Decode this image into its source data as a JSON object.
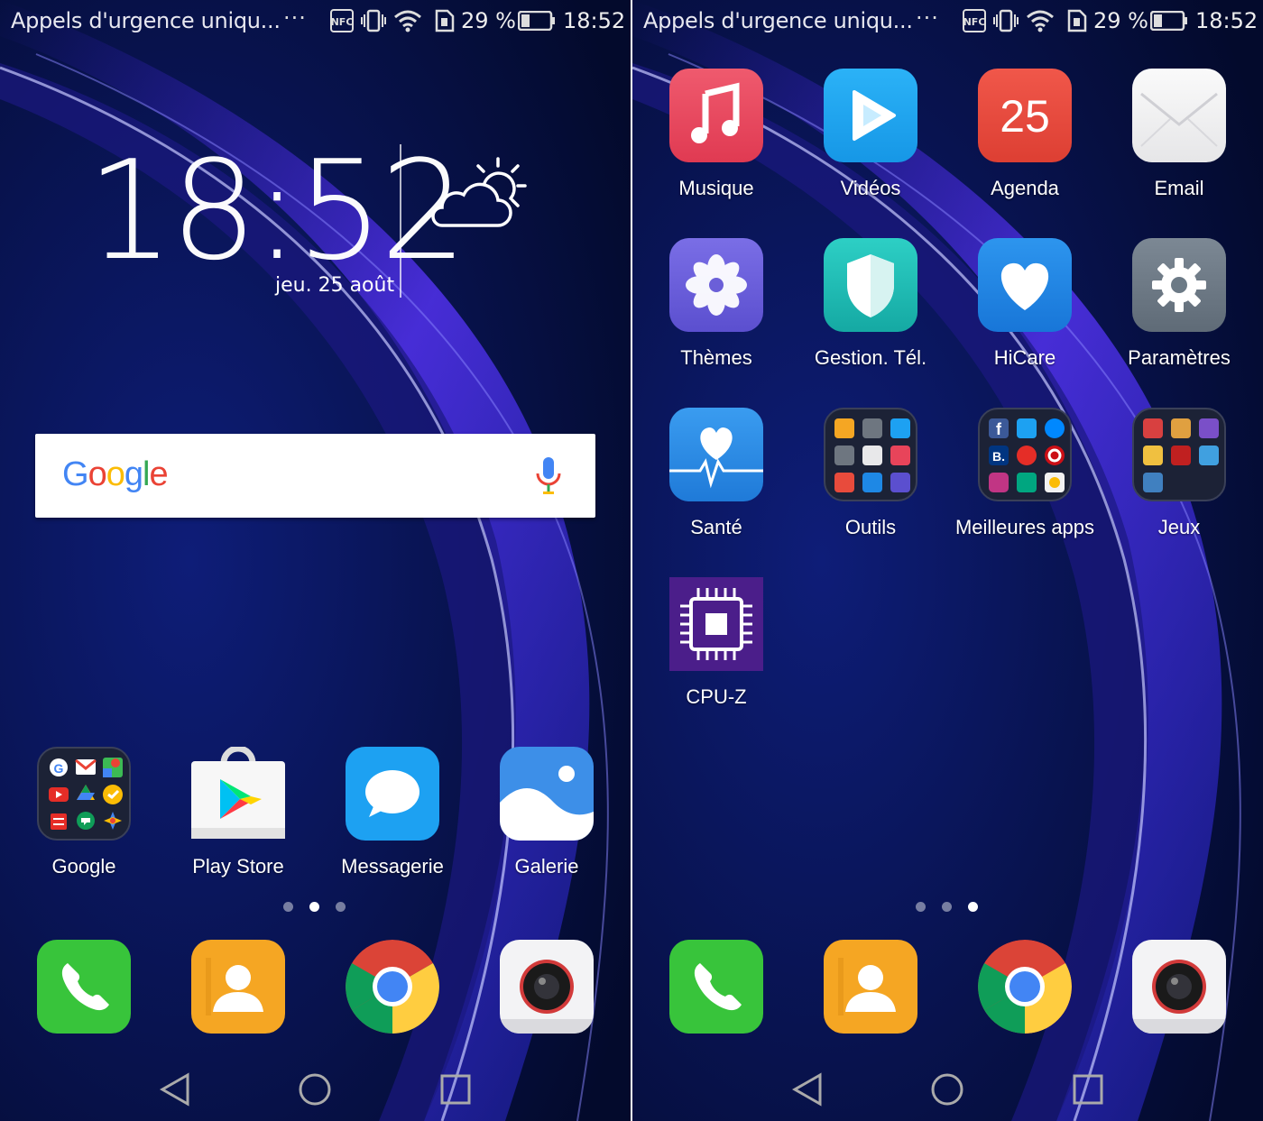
{
  "status": {
    "carrier": "Appels d'urgence uniqu...",
    "more": "···",
    "nfc": "NFC",
    "battery": "29 %",
    "time": "18:52"
  },
  "left": {
    "clock": "18:52",
    "date": "jeu. 25 août",
    "search": {
      "logo": "Google"
    },
    "apps": [
      "Google",
      "Play Store",
      "Messagerie",
      "Galerie"
    ],
    "page_indicator": {
      "count": 3,
      "active": 2
    }
  },
  "right": {
    "apps": [
      "Musique",
      "Vidéos",
      "Agenda",
      "Email",
      "Thèmes",
      "Gestion. Tél.",
      "HiCare",
      "Paramètres",
      "Santé",
      "Outils",
      "Meilleures apps",
      "Jeux",
      "CPU-Z"
    ],
    "agenda_day": "25",
    "page_indicator": {
      "count": 3,
      "active": 3
    }
  },
  "dock": [
    "phone-app",
    "contacts-app",
    "chrome-app",
    "camera-app"
  ],
  "colors": {
    "background": "#06104a",
    "music": "#e8445a",
    "videos": "#1da1f2",
    "agenda": "#e84b3c",
    "themes": "#6b5fd8",
    "phone_manager": "#1fb9b3",
    "hicare": "#1e88e5",
    "settings": "#6c7a86",
    "health": "#2e8be6",
    "cpuz": "#4b1e8a",
    "phone": "#3fc43f",
    "contacts": "#f5a623"
  }
}
